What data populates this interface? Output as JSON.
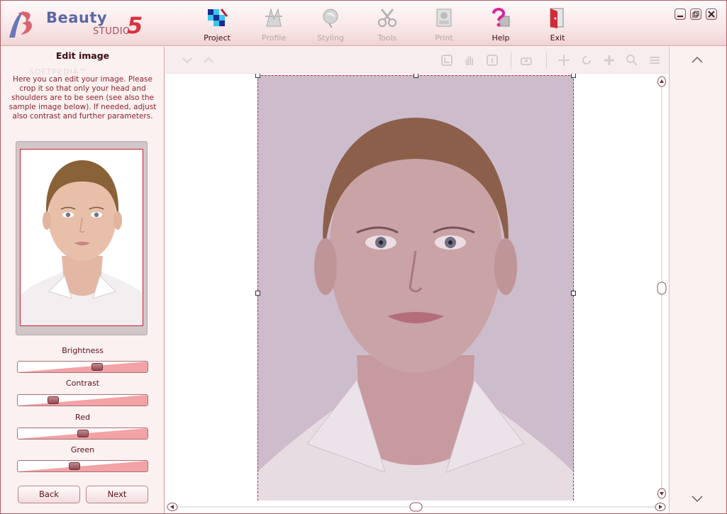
{
  "app": {
    "logo_word": "Beauty",
    "logo_studio": "STUDIO",
    "logo_number": "5"
  },
  "nav": [
    {
      "label": "Project",
      "icon": "project-icon",
      "enabled": true
    },
    {
      "label": "Profile",
      "icon": "profile-icon",
      "enabled": false
    },
    {
      "label": "Styling",
      "icon": "styling-icon",
      "enabled": false
    },
    {
      "label": "Tools",
      "icon": "tools-icon",
      "enabled": false
    },
    {
      "label": "Print",
      "icon": "print-icon",
      "enabled": false
    },
    {
      "label": "Help",
      "icon": "help-icon",
      "enabled": true
    },
    {
      "label": "Exit",
      "icon": "exit-icon",
      "enabled": true
    }
  ],
  "window_controls": [
    "minimize",
    "maximize",
    "close"
  ],
  "left_panel": {
    "title": "Edit image",
    "watermark": "SOFTPEDIA™",
    "instructions": "Here you can edit your image. Please crop it so that only your head and shoulders are to be seen (see also the sample image below). If needed, adjust also contrast and further parameters.",
    "sliders": [
      {
        "label": "Brightness",
        "value": 0.62
      },
      {
        "label": "Contrast",
        "value": 0.25
      },
      {
        "label": "Red",
        "value": 0.5
      },
      {
        "label": "Green",
        "value": 0.43
      }
    ],
    "back_label": "Back",
    "next_label": "Next"
  },
  "colors": {
    "accent": "#d11f30",
    "panel_bg": "#fbf1f0",
    "slider_ramp": "#f19a9c",
    "photo_bg": "#cdbccc"
  }
}
